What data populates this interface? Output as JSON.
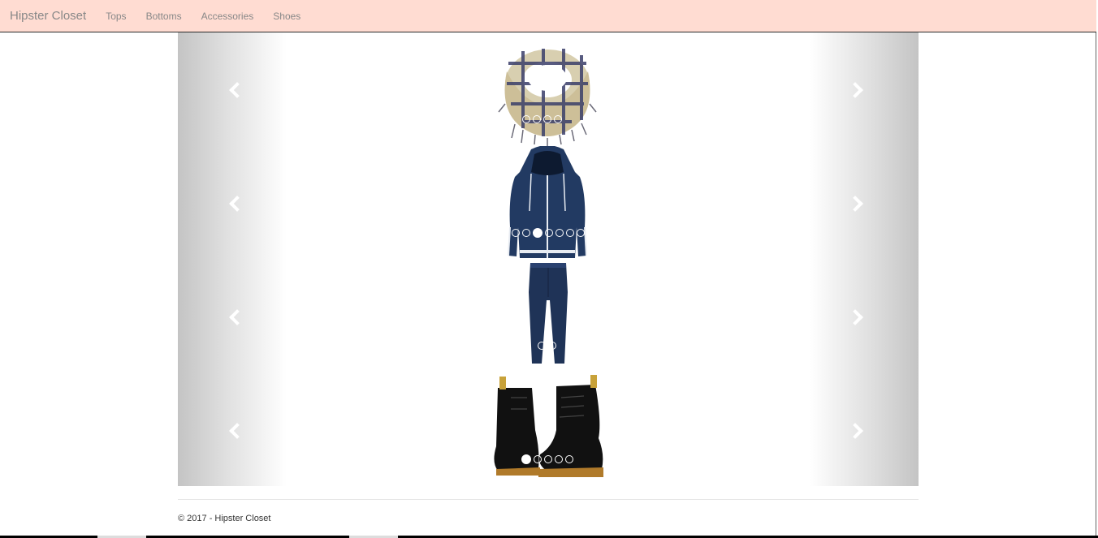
{
  "navbar": {
    "brand": "Hipster Closet",
    "items": [
      "Tops",
      "Bottoms",
      "Accessories",
      "Shoes"
    ]
  },
  "carousels": [
    {
      "name": "accessories",
      "item": "scarf-image",
      "slides": 4,
      "active": 0
    },
    {
      "name": "tops",
      "item": "hoodie-image",
      "slides": 7,
      "active": 2
    },
    {
      "name": "bottoms",
      "item": "jeans-image",
      "slides": 2,
      "active": -1
    },
    {
      "name": "shoes",
      "item": "boots-image",
      "slides": 5,
      "active": 0
    }
  ],
  "footer": {
    "text": "© 2017 - Hipster Closet"
  },
  "colors": {
    "navbar": "#ffdcd2",
    "denim": "#1f3357",
    "boot": "#111111"
  }
}
